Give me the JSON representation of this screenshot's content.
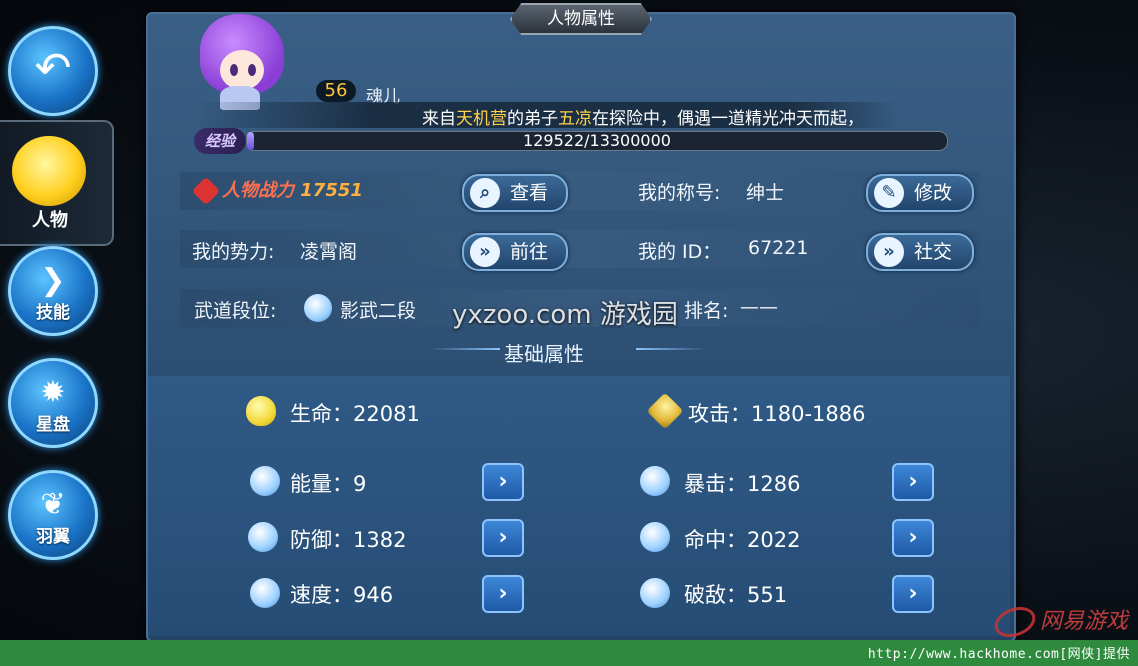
{
  "panel_title": "人物属性",
  "side_nav": {
    "items": [
      {
        "label": "人物",
        "icon": "character-icon",
        "active": true
      },
      {
        "label": "技能",
        "icon": "skill-icon"
      },
      {
        "label": "星盘",
        "icon": "star-chart-icon"
      },
      {
        "label": "羽翼",
        "icon": "wings-icon"
      }
    ]
  },
  "character": {
    "level": "56",
    "name": "魂儿",
    "story": {
      "prefix": "来自",
      "place": "天机营",
      "mid": "的弟子",
      "who": "五凉",
      "suffix": "在探险中，偶遇一道精光冲天而起，"
    },
    "exp_label": "经验",
    "exp_text": "129522/13300000",
    "exp_fraction": 0.0097
  },
  "info": {
    "power_label": "人物战力",
    "power_value": "17551",
    "view_button": "查看",
    "title_label": "我的称号:",
    "title_value": "绅士",
    "edit_button": "修改",
    "faction_label": "我的势力:",
    "faction_value": "凌霄阁",
    "go_button": "前往",
    "id_label": "我的 ID：",
    "id_value": "67221",
    "social_button": "社交",
    "rank_label": "武道段位:",
    "rank_value": "影武二段",
    "ranking_label": "排名:",
    "ranking_value": "——"
  },
  "base_attrs": {
    "header": "基础属性",
    "hp": {
      "label": "生命：",
      "value": "22081"
    },
    "atk": {
      "label": "攻击：",
      "value": "1180-1886"
    },
    "energy": {
      "label": "能量：",
      "value": "9"
    },
    "crit": {
      "label": "暴击：",
      "value": "1286"
    },
    "defense": {
      "label": "防御：",
      "value": "1382"
    },
    "hit": {
      "label": "命中：",
      "value": "2022"
    },
    "speed": {
      "label": "速度：",
      "value": "946"
    },
    "pierce": {
      "label": "破敌：",
      "value": "551"
    }
  },
  "watermarks": {
    "site": "yxzoo.com 游戏园",
    "brand": "网易游戏",
    "footer": "http://www.hackhome.com[网侠]提供"
  },
  "colors": {
    "accent": "#ffd24a",
    "panel": "#2d4f74",
    "footer_bar": "#2e8b3e"
  }
}
